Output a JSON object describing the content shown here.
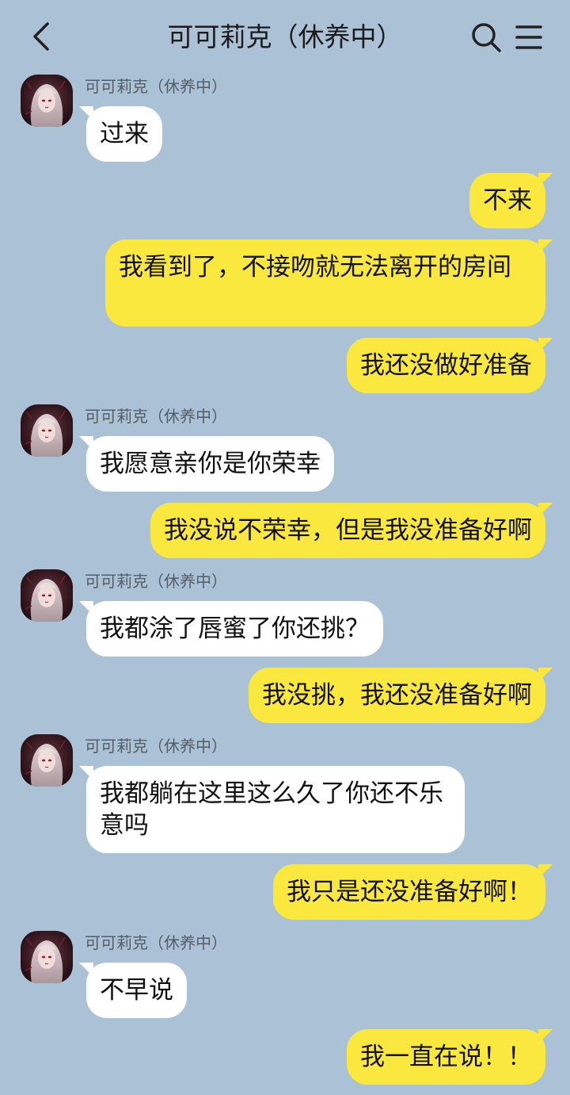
{
  "header": {
    "title": "可可莉克（休养中）"
  },
  "colors": {
    "background": "#abc1d5",
    "incoming_bubble": "#ffffff",
    "outgoing_bubble": "#fbe83e"
  },
  "icons": {
    "back": "chevron-left-icon",
    "search": "search-icon",
    "menu": "menu-icon"
  },
  "contact": {
    "name": "可可莉克（休养中）"
  },
  "messages": [
    {
      "from": "contact",
      "text": "过来"
    },
    {
      "from": "me",
      "text": "不来"
    },
    {
      "from": "me",
      "text": "我看到了，不接吻就无法离开的房间"
    },
    {
      "from": "me",
      "text": "我还没做好准备"
    },
    {
      "from": "contact",
      "text": "我愿意亲你是你荣幸"
    },
    {
      "from": "me",
      "text": "我没说不荣幸，但是我没准备好啊"
    },
    {
      "from": "contact",
      "text": "我都涂了唇蜜了你还挑？"
    },
    {
      "from": "me",
      "text": "我没挑，我还没准备好啊"
    },
    {
      "from": "contact",
      "text": "我都躺在这里这么久了你还不乐意吗"
    },
    {
      "from": "me",
      "text": "我只是还没准备好啊！"
    },
    {
      "from": "contact",
      "text": "不早说"
    },
    {
      "from": "me",
      "text": "我一直在说！！"
    }
  ]
}
